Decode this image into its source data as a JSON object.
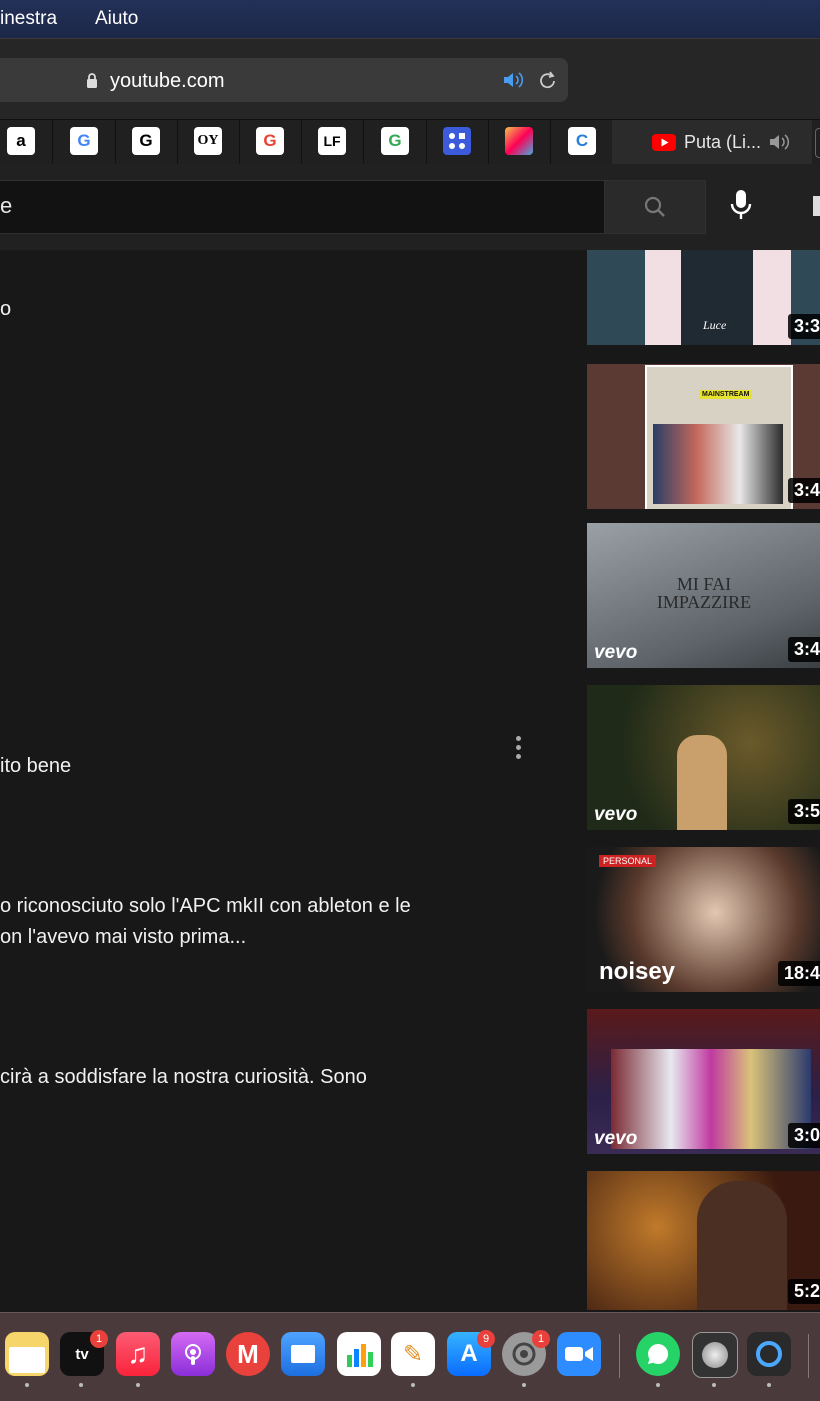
{
  "menubar": {
    "items": [
      "inestra",
      "Aiuto"
    ]
  },
  "browser": {
    "url": "youtube.com",
    "active_tab_title": "Puta (Li...",
    "favicons": [
      "amazon-icon",
      "google-icon",
      "g-icon",
      "oy-icon",
      "google-icon",
      "lf-icon",
      "google-icon",
      "grid-app-icon",
      "colorful-app-icon",
      "c-app-icon"
    ],
    "favicon_glyphs": [
      "a",
      "G",
      "G",
      "OY",
      "G",
      "LF",
      "G",
      "",
      "",
      "C"
    ]
  },
  "youtube": {
    "search_text": "e"
  },
  "comments": {
    "line1": "o",
    "line2": "ito bene",
    "line3": "o riconosciuto solo l'APC mkII con ableton e le",
    "line4": "on l'avevo mai visto prima...",
    "line5": "cirà a soddisfare la nostra curiosità. Sono"
  },
  "sidebar": {
    "videos": [
      {
        "duration": "3:3",
        "overlay": "Luce"
      },
      {
        "duration": "3:4",
        "overlay": "MAINSTREAM"
      },
      {
        "duration": "3:4",
        "overlay": "MI FAI IMPAZZIRE",
        "brand": "vevo"
      },
      {
        "duration": "3:5",
        "brand": "vevo"
      },
      {
        "duration": "18:4",
        "overlay": "PERSONAL",
        "brand": "noisey"
      },
      {
        "duration": "3:0",
        "brand": "vevo"
      },
      {
        "duration": "5:2"
      }
    ]
  },
  "dock": {
    "tv_label": "tv",
    "tv_badge": "1",
    "appstore_badge": "9",
    "settings_badge": "1"
  }
}
